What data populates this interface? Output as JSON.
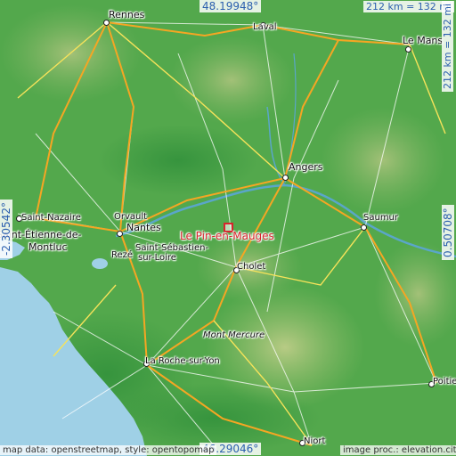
{
  "place": {
    "name": "Le Pin-en-Mauges"
  },
  "coords": {
    "top": "48.19948°",
    "bottom": "46.29046°",
    "left": "-2.30542°",
    "right": "0.50708°"
  },
  "scale": {
    "horizontal": "212 km = 132 mi",
    "vertical": "212 km = 132 mi"
  },
  "credits": {
    "left": "map data: openstreetmap, style: opentopomap",
    "right": "image proc.: elevation.city"
  },
  "cities": [
    {
      "name": "Rennes",
      "cls": "big"
    },
    {
      "name": "Laval",
      "cls": ""
    },
    {
      "name": "Le Mans",
      "cls": "big"
    },
    {
      "name": "Angers",
      "cls": "big"
    },
    {
      "name": "Saumur",
      "cls": ""
    },
    {
      "name": "Nantes",
      "cls": "big"
    },
    {
      "name": "Saint-Nazaire",
      "cls": ""
    },
    {
      "name": "Orvault",
      "cls": ""
    },
    {
      "name": "Saint-Étienne-de-",
      "cls": "big"
    },
    {
      "name": "Montluc",
      "cls": "big"
    },
    {
      "name": "Rezé",
      "cls": ""
    },
    {
      "name": "Saint-Sébastien-",
      "cls": ""
    },
    {
      "name": "sur-Loire",
      "cls": ""
    },
    {
      "name": "Cholet",
      "cls": ""
    },
    {
      "name": "Mont Mercure",
      "cls": "italic"
    },
    {
      "name": "La Roche-sur-Yon",
      "cls": ""
    },
    {
      "name": "Poitiers",
      "cls": ""
    },
    {
      "name": "Niort",
      "cls": ""
    }
  ]
}
